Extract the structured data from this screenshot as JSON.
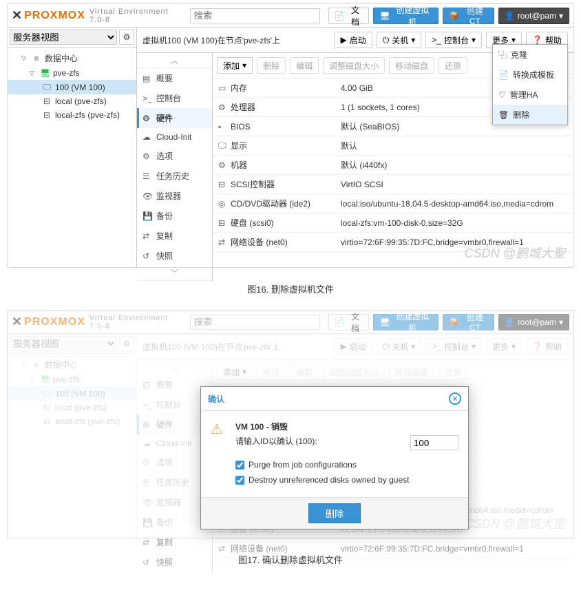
{
  "logo": {
    "brand": "PROXMOX",
    "sub": "Virtual Environment 7.0-8"
  },
  "search_placeholder": "搜索",
  "topbuttons": {
    "docs": "文档",
    "create_vm": "创建虚拟机",
    "create_ct": "创建CT",
    "user": "root@pam"
  },
  "view_selector": "服务器视图",
  "tree": {
    "datacenter": "数据中心",
    "node": "pve-zfs",
    "vm": "100 (VM 100)",
    "storage1": "local (pve-zfs)",
    "storage2": "local-zfs (pve-zfs)"
  },
  "title": "虚拟机100 (VM 100)在节点'pve-zfs'上",
  "actions": {
    "start": "启动",
    "shutdown": "关机",
    "console": "控制台",
    "more": "更多",
    "help": "帮助"
  },
  "tabs": {
    "summary": "概要",
    "console": "控制台",
    "hardware": "硬件",
    "cloudinit": "Cloud-Init",
    "options": "选项",
    "taskhistory": "任务历史",
    "monitor": "监视器",
    "backup": "备份",
    "replication": "复制",
    "snapshot": "快照"
  },
  "toolbar": {
    "add": "添加",
    "remove": "删除",
    "edit": "编辑",
    "resize": "调整磁盘大小",
    "move": "移动磁盘",
    "revert": "还原"
  },
  "hardware": [
    {
      "icon": "▭",
      "key": "内存",
      "val": "4.00 GiB"
    },
    {
      "icon": "⚙",
      "key": "处理器",
      "val": "1 (1 sockets, 1 cores)"
    },
    {
      "icon": "▪",
      "key": "BIOS",
      "val": "默认 (SeaBIOS)"
    },
    {
      "icon": "🖵",
      "key": "显示",
      "val": "默认"
    },
    {
      "icon": "⚙",
      "key": "机器",
      "val": "默认 (i440fx)"
    },
    {
      "icon": "⊟",
      "key": "SCSI控制器",
      "val": "VirtIO SCSI"
    },
    {
      "icon": "◎",
      "key": "CD/DVD驱动器 (ide2)",
      "val": "local:iso/ubuntu-18.04.5-desktop-amd64.iso,media=cdrom"
    },
    {
      "icon": "⊟",
      "key": "硬盘 (scsi0)",
      "val": "local-zfs:vm-100-disk-0,size=32G"
    },
    {
      "icon": "⇄",
      "key": "网络设备 (net0)",
      "val": "virtio=72:6F:99:35:7D:FC,bridge=vmbr0,firewall=1"
    }
  ],
  "dropdown": {
    "clone": "克隆",
    "template": "转换成模板",
    "ha": "管理HA",
    "delete": "删除"
  },
  "watermark": "CSDN @鹏城大聖",
  "caption1": "图16. 删除虚拟机文件",
  "dialog": {
    "title": "确认",
    "heading": "VM 100 - 销毁",
    "prompt": "请输入ID以确认 (100):",
    "input_value": "100",
    "cb1": "Purge from job configurations",
    "cb2": "Destroy unreferenced disks owned by guest",
    "button": "删除"
  },
  "caption2": "图17. 确认删除虚拟机文件"
}
